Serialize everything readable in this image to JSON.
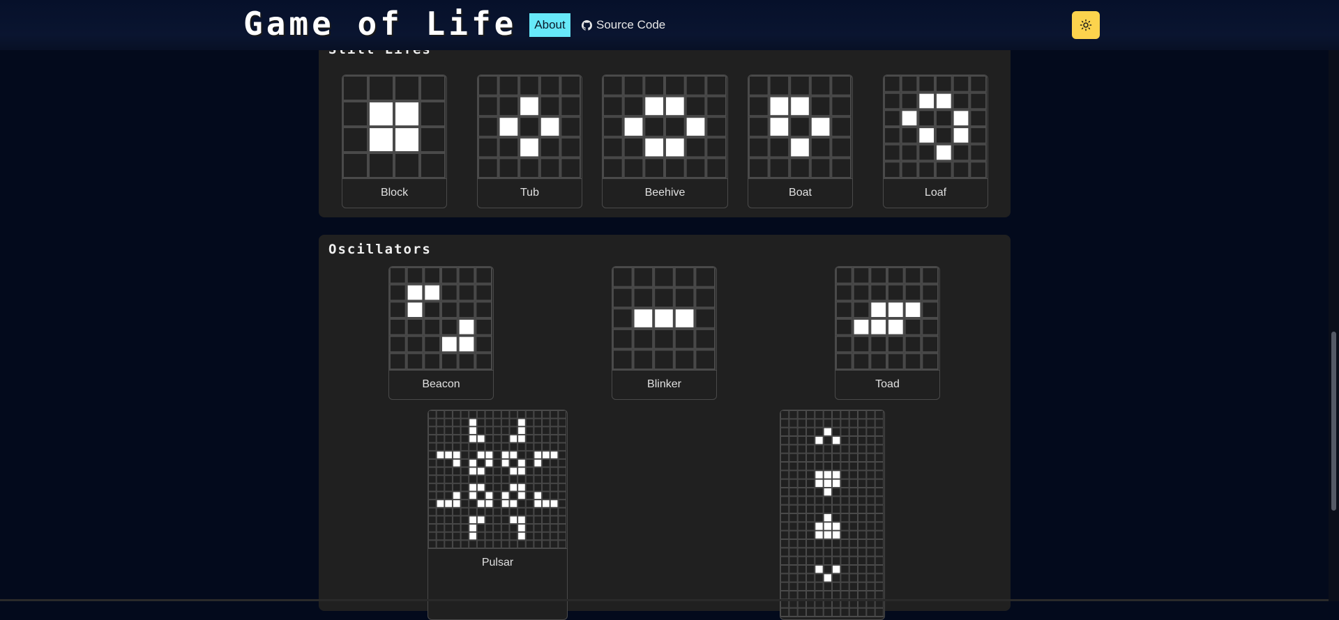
{
  "header": {
    "title": "Game of Life",
    "nav": {
      "about": "About",
      "source_code": "Source Code"
    },
    "icons": {
      "source": "github-icon",
      "theme": "sun-icon"
    }
  },
  "sections": [
    {
      "title": "Still Lifes",
      "patterns": [
        {
          "name": "Block",
          "rows": 4,
          "cols": 4,
          "cells": [
            [
              1,
              1
            ],
            [
              1,
              2
            ],
            [
              2,
              1
            ],
            [
              2,
              2
            ]
          ]
        },
        {
          "name": "Tub",
          "rows": 5,
          "cols": 5,
          "cells": [
            [
              1,
              2
            ],
            [
              2,
              1
            ],
            [
              2,
              3
            ],
            [
              3,
              2
            ]
          ]
        },
        {
          "name": "Beehive",
          "rows": 5,
          "cols": 6,
          "cells": [
            [
              1,
              2
            ],
            [
              1,
              3
            ],
            [
              2,
              1
            ],
            [
              2,
              4
            ],
            [
              3,
              2
            ],
            [
              3,
              3
            ]
          ]
        },
        {
          "name": "Boat",
          "rows": 5,
          "cols": 5,
          "cells": [
            [
              1,
              1
            ],
            [
              1,
              2
            ],
            [
              2,
              1
            ],
            [
              2,
              3
            ],
            [
              3,
              2
            ]
          ]
        },
        {
          "name": "Loaf",
          "rows": 6,
          "cols": 6,
          "cells": [
            [
              1,
              2
            ],
            [
              1,
              3
            ],
            [
              2,
              1
            ],
            [
              2,
              4
            ],
            [
              3,
              2
            ],
            [
              3,
              4
            ],
            [
              4,
              3
            ]
          ]
        }
      ]
    },
    {
      "title": "Oscillators",
      "patterns": [
        {
          "name": "Beacon",
          "rows": 6,
          "cols": 6,
          "cells": [
            [
              1,
              1
            ],
            [
              1,
              2
            ],
            [
              2,
              1
            ],
            [
              3,
              4
            ],
            [
              4,
              3
            ],
            [
              4,
              4
            ]
          ]
        },
        {
          "name": "Blinker",
          "rows": 5,
          "cols": 5,
          "cells": [
            [
              2,
              1
            ],
            [
              2,
              2
            ],
            [
              2,
              3
            ]
          ]
        },
        {
          "name": "Toad",
          "rows": 6,
          "cols": 6,
          "cells": [
            [
              2,
              2
            ],
            [
              2,
              3
            ],
            [
              2,
              4
            ],
            [
              3,
              1
            ],
            [
              3,
              2
            ],
            [
              3,
              3
            ]
          ]
        },
        {
          "name": "Pulsar",
          "rows": 17,
          "cols": 17,
          "cells": [
            [
              1,
              5
            ],
            [
              1,
              11
            ],
            [
              2,
              5
            ],
            [
              2,
              11
            ],
            [
              3,
              5
            ],
            [
              3,
              6
            ],
            [
              3,
              10
            ],
            [
              3,
              11
            ],
            [
              5,
              1
            ],
            [
              5,
              2
            ],
            [
              5,
              3
            ],
            [
              5,
              6
            ],
            [
              5,
              7
            ],
            [
              5,
              9
            ],
            [
              5,
              10
            ],
            [
              5,
              13
            ],
            [
              5,
              14
            ],
            [
              5,
              15
            ],
            [
              6,
              3
            ],
            [
              6,
              5
            ],
            [
              6,
              7
            ],
            [
              6,
              9
            ],
            [
              6,
              11
            ],
            [
              6,
              13
            ],
            [
              7,
              5
            ],
            [
              7,
              6
            ],
            [
              7,
              10
            ],
            [
              7,
              11
            ],
            [
              9,
              5
            ],
            [
              9,
              6
            ],
            [
              9,
              10
            ],
            [
              9,
              11
            ],
            [
              10,
              3
            ],
            [
              10,
              5
            ],
            [
              10,
              7
            ],
            [
              10,
              9
            ],
            [
              10,
              11
            ],
            [
              10,
              13
            ],
            [
              11,
              1
            ],
            [
              11,
              2
            ],
            [
              11,
              3
            ],
            [
              11,
              6
            ],
            [
              11,
              7
            ],
            [
              11,
              9
            ],
            [
              11,
              10
            ],
            [
              11,
              13
            ],
            [
              11,
              14
            ],
            [
              11,
              15
            ],
            [
              13,
              5
            ],
            [
              13,
              6
            ],
            [
              13,
              10
            ],
            [
              13,
              11
            ],
            [
              14,
              5
            ],
            [
              14,
              11
            ],
            [
              15,
              5
            ],
            [
              15,
              11
            ]
          ]
        },
        {
          "name": "",
          "rows": 24,
          "cols": 12,
          "cells": [
            [
              2,
              5
            ],
            [
              3,
              4
            ],
            [
              3,
              6
            ],
            [
              7,
              4
            ],
            [
              7,
              5
            ],
            [
              7,
              6
            ],
            [
              8,
              4
            ],
            [
              8,
              5
            ],
            [
              8,
              6
            ],
            [
              9,
              5
            ],
            [
              12,
              5
            ],
            [
              13,
              4
            ],
            [
              13,
              5
            ],
            [
              13,
              6
            ],
            [
              14,
              4
            ],
            [
              14,
              5
            ],
            [
              14,
              6
            ],
            [
              18,
              4
            ],
            [
              18,
              6
            ],
            [
              19,
              5
            ]
          ]
        }
      ]
    }
  ]
}
